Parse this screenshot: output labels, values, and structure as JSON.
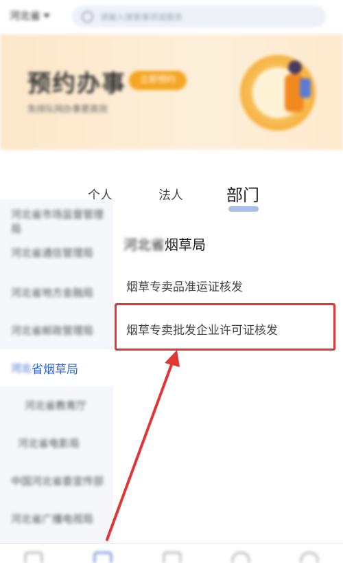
{
  "topbar": {
    "region": "河北省",
    "search_placeholder": "请输入搜索事项或服务"
  },
  "banner": {
    "title": "预约办事",
    "pill": "立即预约",
    "subtitle": "免排队网办事更高效"
  },
  "tabs": {
    "personal": "个人",
    "legal": "法人",
    "department": "部门"
  },
  "sidebar": {
    "items": [
      {
        "label": "河北省市场监督管理局"
      },
      {
        "label": "河北省通信管理局"
      },
      {
        "label": "河北省地方金融局"
      },
      {
        "label": "河北省邮政管理局"
      },
      {
        "label_prefix": "河北",
        "label_main": "省烟草局"
      },
      {
        "label": "河北省教育厅"
      },
      {
        "label": "河北省电影局"
      },
      {
        "label": "中国河北省委宣传部"
      },
      {
        "label": "河北省广播电视局"
      }
    ]
  },
  "panel": {
    "dept_title_prefix": "河北省",
    "dept_title_main": "烟草局",
    "services": [
      "烟草专卖品准运证核发",
      "烟草专卖批发企业许可证核发"
    ]
  },
  "colors": {
    "accent": "#3366cc",
    "highlight": "#e33535",
    "banner_pill": "#f5a623"
  },
  "bottomnav": {
    "icons": [
      "home-icon",
      "service-icon",
      "document-icon",
      "heart-icon",
      "user-icon"
    ]
  }
}
